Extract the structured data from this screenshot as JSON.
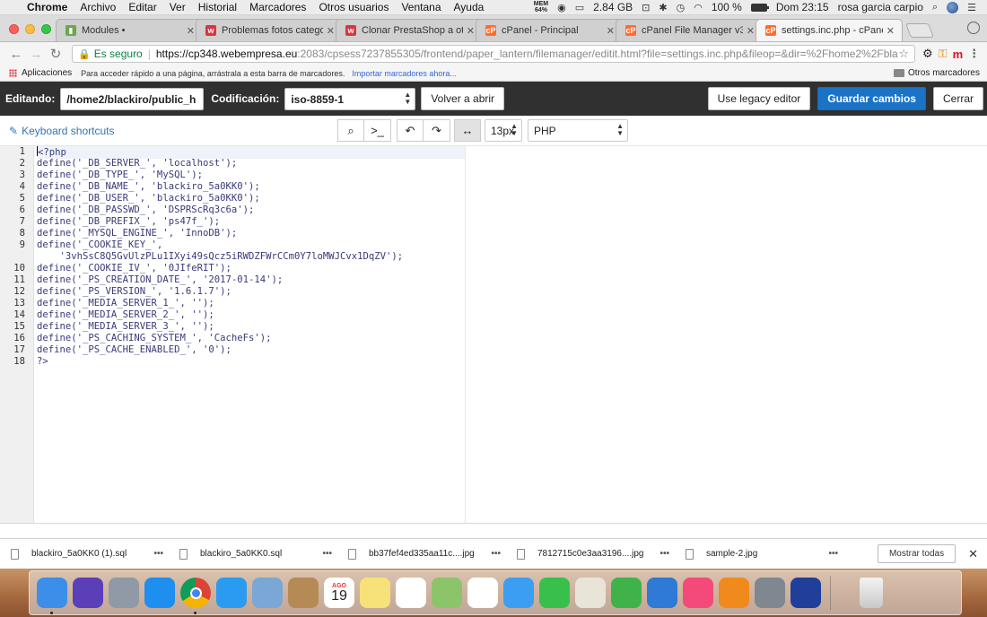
{
  "menubar": {
    "app": "Chrome",
    "items": [
      "Archivo",
      "Editar",
      "Ver",
      "Historial",
      "Marcadores",
      "Otros usuarios",
      "Ventana",
      "Ayuda"
    ],
    "mem_label": "MEM",
    "mem_value": "64%",
    "storage": "2.84 GB",
    "battery_text": "100 %",
    "battery_level": 1.0,
    "datetime": "Dom 23:15",
    "user": "rosa garcia carpio"
  },
  "tabs": [
    {
      "label": "Modules •",
      "fav_color": "#6aa84f",
      "fav_char": "▮"
    },
    {
      "label": "Problemas fotos categorías",
      "fav_color": "#d9363e",
      "fav_char": "w"
    },
    {
      "label": "Clonar PrestaShop a otra ca",
      "fav_color": "#d9363e",
      "fav_char": "w"
    },
    {
      "label": "cPanel - Principal",
      "fav_color": "#ff6c2c",
      "fav_char": "cP"
    },
    {
      "label": "cPanel File Manager v3",
      "fav_color": "#ff6c2c",
      "fav_char": "cP"
    },
    {
      "label": "settings.inc.php - cPanel Fil",
      "fav_color": "#ff6c2c",
      "fav_char": "cP",
      "active": true
    }
  ],
  "address": {
    "secure_label": "Es seguro",
    "host": "https://cp348.webempresa.eu",
    "rest": ":2083/cpsess7237855305/frontend/paper_lantern/filemanager/editit.html?file=settings.inc.php&fileop=&dir=%2Fhome2%2Fblackiro%2Fp..."
  },
  "bookmarks": {
    "apps": "Aplicaciones",
    "hint": "Para acceder rápido a una página, arrástrala a esta barra de marcadores.",
    "import": "Importar marcadores ahora...",
    "other": "Otros marcadores"
  },
  "editor_header": {
    "editing_label": "Editando:",
    "path": "/home2/blackiro/public_h",
    "encoding_label": "Codificación:",
    "encoding": "iso-8859-1",
    "reopen": "Volver a abrir",
    "legacy": "Use legacy editor",
    "save": "Guardar cambios",
    "close": "Cerrar"
  },
  "editor_tools": {
    "shortcuts": "Keyboard shortcuts",
    "font_size": "13px",
    "mode": "PHP"
  },
  "code_lines": [
    {
      "n": "1",
      "text": "<?php"
    },
    {
      "n": "2",
      "text": "define('_DB_SERVER_', 'localhost');"
    },
    {
      "n": "3",
      "text": "define('_DB_TYPE_', 'MySQL');"
    },
    {
      "n": "4",
      "text": "define('_DB_NAME_', 'blackiro_5a0KK0');"
    },
    {
      "n": "5",
      "text": "define('_DB_USER_', 'blackiro_5a0KK0');"
    },
    {
      "n": "6",
      "text": "define('_DB_PASSWD_', 'DSPRScRq3c6a');"
    },
    {
      "n": "7",
      "text": "define('_DB_PREFIX_', 'ps47f_');"
    },
    {
      "n": "8",
      "text": "define('_MYSQL_ENGINE_', 'InnoDB');"
    },
    {
      "n": "9",
      "text": "define('_COOKIE_KEY_',"
    },
    {
      "n": "",
      "text": "    '3vhSsC8Q5GvUlzPLu1IXyi49sQcz5iRWDZFWrCCm0Y7loMWJCvx1DqZV');"
    },
    {
      "n": "10",
      "text": "define('_COOKIE_IV_', '0JIfeRIT');"
    },
    {
      "n": "11",
      "text": "define('_PS_CREATION_DATE_', '2017-01-14');"
    },
    {
      "n": "12",
      "text": "define('_PS_VERSION_', '1.6.1.7');"
    },
    {
      "n": "13",
      "text": "define('_MEDIA_SERVER_1_', '');"
    },
    {
      "n": "14",
      "text": "define('_MEDIA_SERVER_2_', '');"
    },
    {
      "n": "15",
      "text": "define('_MEDIA_SERVER_3_', '');"
    },
    {
      "n": "16",
      "text": "define('_PS_CACHING_SYSTEM_', 'CacheFs');"
    },
    {
      "n": "17",
      "text": "define('_PS_CACHE_ENABLED_', '0');"
    },
    {
      "n": "18",
      "text": "?>"
    }
  ],
  "downloads": {
    "items": [
      "blackiro_5a0KK0 (1).sql",
      "blackiro_5a0KK0.sql",
      "bb37fef4ed335aa11c....jpg",
      "7812715c0e3aa3196....jpg",
      "sample-2.jpg"
    ],
    "more": "•••",
    "show_all": "Mostrar todas"
  },
  "dock": {
    "calendar_month": "AGO",
    "calendar_day": "19",
    "icons": [
      {
        "name": "finder",
        "color": "#3d8ee8",
        "running": true
      },
      {
        "name": "siri",
        "color": "#5b3fb8",
        "running": false
      },
      {
        "name": "launchpad",
        "color": "#8f9aa6",
        "running": false
      },
      {
        "name": "app-store",
        "color": "#1e8ef0",
        "running": false
      },
      {
        "name": "chrome",
        "color": "#ffffff",
        "running": true
      },
      {
        "name": "safari",
        "color": "#2a9bf0",
        "running": false
      },
      {
        "name": "mail-eagle",
        "color": "#7ba7d6",
        "running": false
      },
      {
        "name": "contacts",
        "color": "#b58a55",
        "running": false
      },
      {
        "name": "calendar",
        "color": "#ffffff",
        "running": false
      },
      {
        "name": "notes",
        "color": "#f7e27a",
        "running": false
      },
      {
        "name": "reminders",
        "color": "#ffffff",
        "running": false
      },
      {
        "name": "maps",
        "color": "#8cc46a",
        "running": false
      },
      {
        "name": "photos",
        "color": "#ffffff",
        "running": false
      },
      {
        "name": "messages",
        "color": "#3b9ef3",
        "running": false
      },
      {
        "name": "facetime",
        "color": "#37c14c",
        "running": false
      },
      {
        "name": "textedit",
        "color": "#e9e4d8",
        "running": false
      },
      {
        "name": "numbers",
        "color": "#3fb24a",
        "running": false
      },
      {
        "name": "keynote",
        "color": "#2e7ad4",
        "running": false
      },
      {
        "name": "itunes",
        "color": "#f34a7a",
        "running": false
      },
      {
        "name": "ibooks",
        "color": "#f08a1c",
        "running": false
      },
      {
        "name": "system-preferences",
        "color": "#7f8790",
        "running": false
      },
      {
        "name": "filezilla",
        "color": "#1f3f9a",
        "running": false
      }
    ]
  }
}
